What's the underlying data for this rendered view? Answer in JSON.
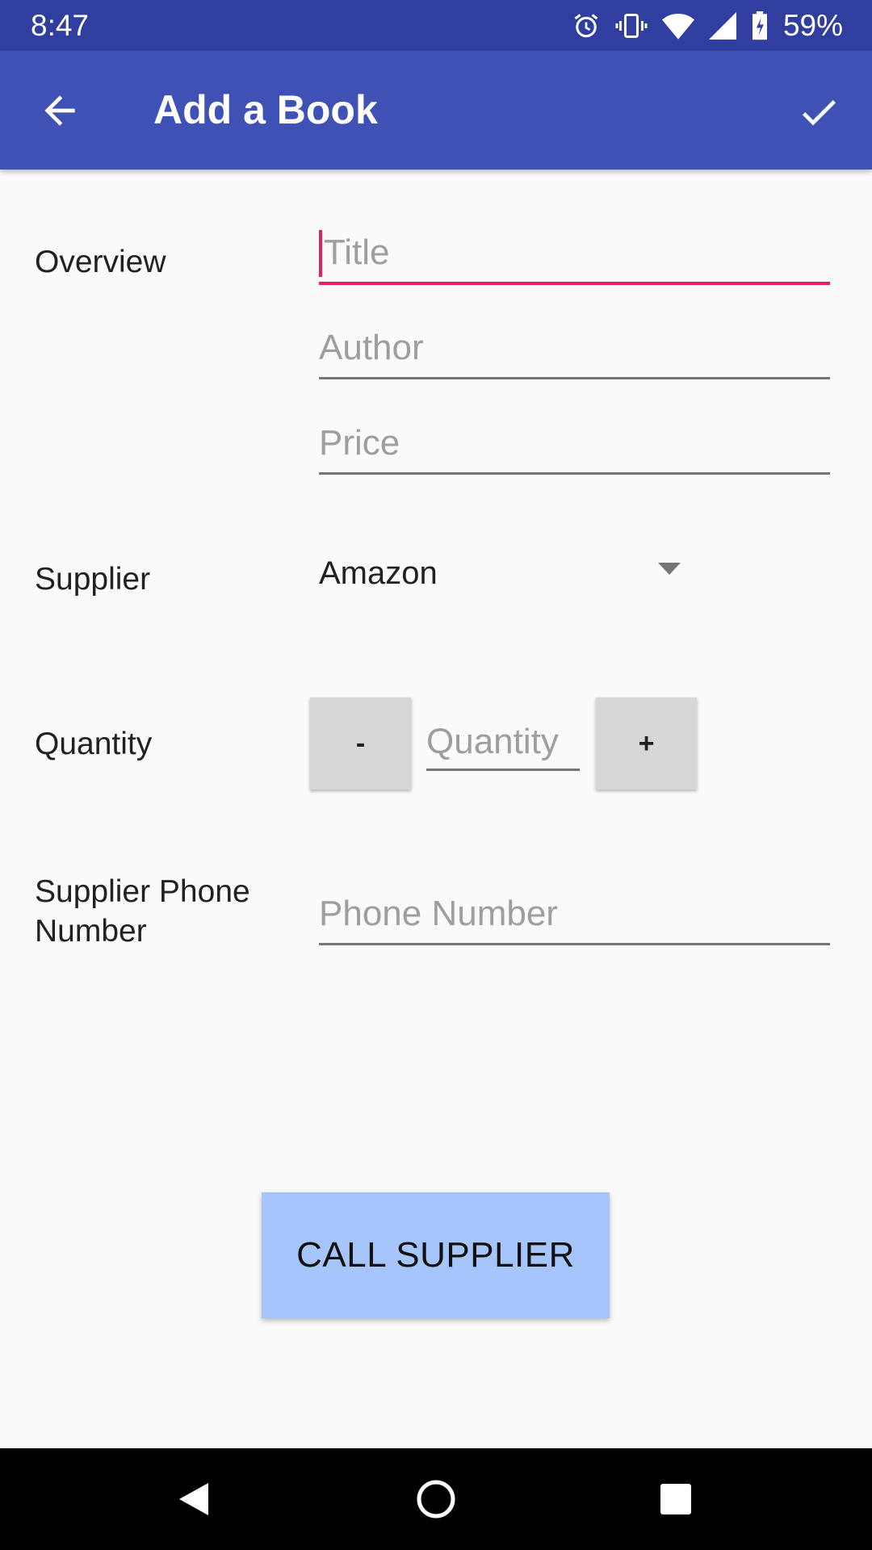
{
  "status_bar": {
    "time": "8:47",
    "battery_percent": "59%",
    "icons": [
      "alarm-icon",
      "vibrate-icon",
      "wifi-icon",
      "signal-icon",
      "battery-icon"
    ]
  },
  "app_bar": {
    "title": "Add a Book",
    "back_icon": "arrow-back-icon",
    "save_icon": "check-icon",
    "color": "#3f51b5"
  },
  "form": {
    "overview_label": "Overview",
    "title_placeholder": "Title",
    "author_placeholder": "Author",
    "price_placeholder": "Price",
    "supplier_label": "Supplier",
    "supplier_selected": "Amazon",
    "quantity_label": "Quantity",
    "decrement_label": "-",
    "increment_label": "+",
    "quantity_placeholder": "Quantity",
    "phone_label_line1": "Supplier Phone",
    "phone_label_line2": "Number",
    "phone_placeholder": "Phone Number",
    "focus_color": "#e91e63"
  },
  "actions": {
    "call_supplier_label": "CALL SUPPLIER",
    "call_button_color": "#a6c5fa"
  },
  "nav_bar": {
    "icons": [
      "nav-back-icon",
      "nav-home-icon",
      "nav-recents-icon"
    ]
  }
}
